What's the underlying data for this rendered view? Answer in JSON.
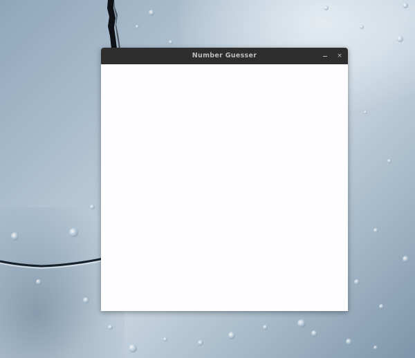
{
  "window": {
    "title": "Number Guesser",
    "minimize_icon": "minimize-icon",
    "close_icon": "close-icon",
    "close_glyph": "×"
  },
  "colors": {
    "titlebar": "#2e2e2e",
    "title_text": "#bdbdbd",
    "content_background": "#fefdff"
  }
}
